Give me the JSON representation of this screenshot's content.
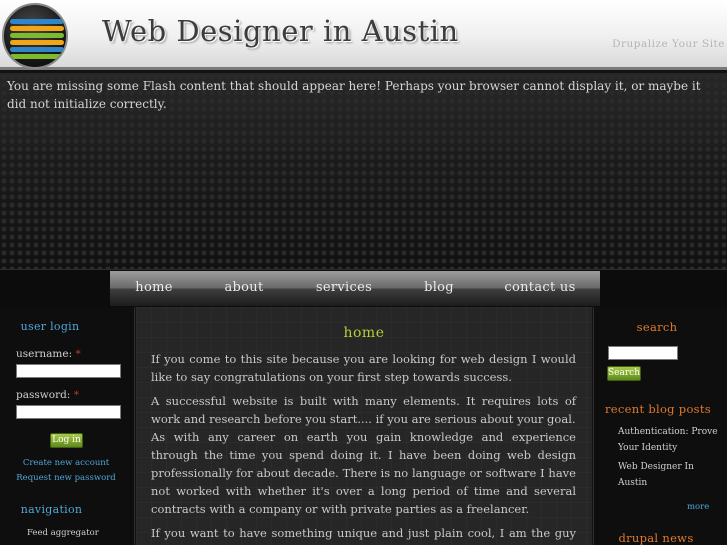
{
  "header": {
    "site_name": "Web Designer in Austin",
    "slogan": "Drupalize Your Site"
  },
  "flash": {
    "message": "You are missing some Flash content that should appear here! Perhaps your browser cannot display it, or maybe it did not initialize correctly."
  },
  "nav": {
    "items": [
      {
        "label": "home"
      },
      {
        "label": "about"
      },
      {
        "label": "services"
      },
      {
        "label": "blog"
      },
      {
        "label": "contact us"
      }
    ]
  },
  "login": {
    "title": "user login",
    "username_label": "username:",
    "password_label": "password:",
    "required_mark": "*",
    "button": "Log in",
    "create_account": "Create new account",
    "request_password": "Request new password"
  },
  "navigation": {
    "title": "navigation",
    "items": [
      {
        "label": "Feed aggregator"
      }
    ]
  },
  "main": {
    "title": "home",
    "paragraphs": [
      "If you come to this site because you are looking for web design I would like to say congratulations on your first step towards success.",
      "A successful website is built with many elements. It requires lots of work and research before you start.... if you are serious about your goal.",
      "As with any career on earth you gain knowledge and experience through the time you spend doing it. I have been doing web design professionally for about decade. There is no language or software I have not worked with whether it's over a long period of time and several contracts with a company or with private parties as a freelancer.",
      "If you want to have something unique and just plain cool, I am the guy for you."
    ]
  },
  "search": {
    "title": "search",
    "button": "Search"
  },
  "recent_blog": {
    "title": "recent blog posts",
    "items": [
      {
        "label": "Authentication: Prove Your Identity"
      },
      {
        "label": "Web Designer In Austin"
      }
    ],
    "more": "more"
  },
  "drupal_news": {
    "title": "drupal news"
  },
  "colors": {
    "accent_blue": "#4fa6d6",
    "accent_green": "#b8cc3a",
    "accent_orange": "#e07a2e",
    "required_red": "#c23a2c",
    "button_green": "#7fae2e"
  }
}
